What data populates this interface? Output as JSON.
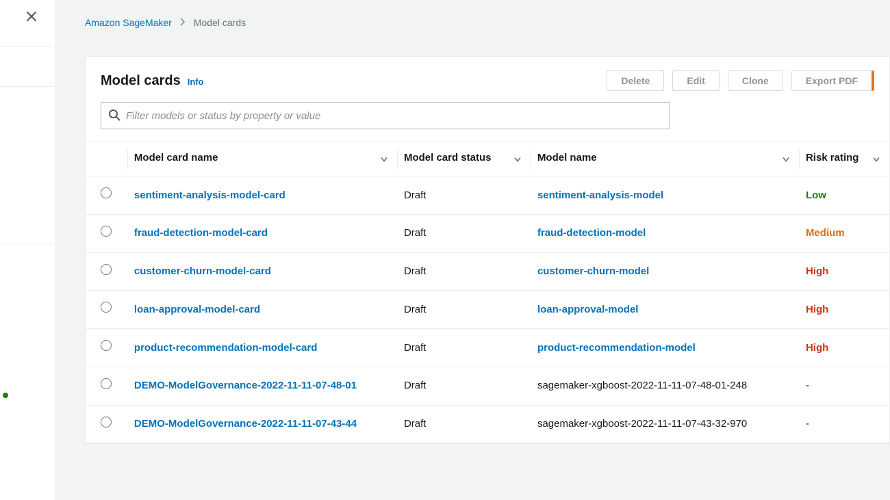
{
  "breadcrumbs": {
    "root": "Amazon SageMaker",
    "current": "Model cards"
  },
  "header": {
    "title": "Model cards",
    "info": "Info"
  },
  "buttons": {
    "delete": "Delete",
    "edit": "Edit",
    "clone": "Clone",
    "export": "Export PDF"
  },
  "filter": {
    "placeholder": "Filter models or status by property or value"
  },
  "columns": {
    "card_name": "Model card name",
    "status": "Model card status",
    "model_name": "Model name",
    "risk": "Risk rating"
  },
  "rows": [
    {
      "card_name": "sentiment-analysis-model-card",
      "status": "Draft",
      "model_name": "sentiment-analysis-model",
      "model_link": true,
      "risk": "Low"
    },
    {
      "card_name": "fraud-detection-model-card",
      "status": "Draft",
      "model_name": "fraud-detection-model",
      "model_link": true,
      "risk": "Medium"
    },
    {
      "card_name": "customer-churn-model-card",
      "status": "Draft",
      "model_name": "customer-churn-model",
      "model_link": true,
      "risk": "High"
    },
    {
      "card_name": "loan-approval-model-card",
      "status": "Draft",
      "model_name": "loan-approval-model",
      "model_link": true,
      "risk": "High"
    },
    {
      "card_name": "product-recommendation-model-card",
      "status": "Draft",
      "model_name": "product-recommendation-model",
      "model_link": true,
      "risk": "High"
    },
    {
      "card_name": "DEMO-ModelGovernance-2022-11-11-07-48-01",
      "status": "Draft",
      "model_name": "sagemaker-xgboost-2022-11-11-07-48-01-248",
      "model_link": false,
      "risk": "-"
    },
    {
      "card_name": "DEMO-ModelGovernance-2022-11-11-07-43-44",
      "status": "Draft",
      "model_name": "sagemaker-xgboost-2022-11-11-07-43-32-970",
      "model_link": false,
      "risk": "-"
    }
  ]
}
